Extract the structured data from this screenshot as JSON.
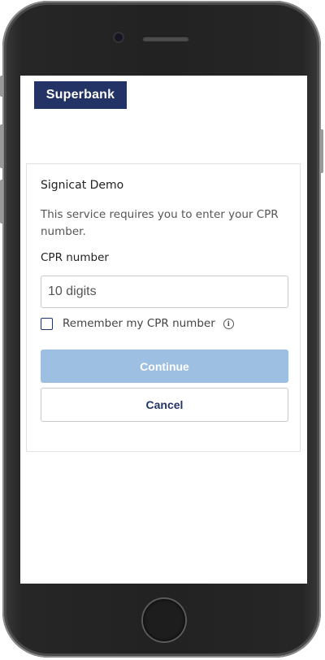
{
  "brand": {
    "logo_text": "Superbank",
    "color": "#233366"
  },
  "card": {
    "title": "Signicat Demo",
    "description": "This service requires you to enter your CPR number."
  },
  "cpr_field": {
    "label": "CPR number",
    "placeholder": "10 digits",
    "value": ""
  },
  "remember": {
    "label": "Remember my CPR number",
    "checked": false,
    "info_icon": "info-icon"
  },
  "buttons": {
    "continue_label": "Continue",
    "continue_color": "#9dbfe2",
    "cancel_label": "Cancel"
  }
}
